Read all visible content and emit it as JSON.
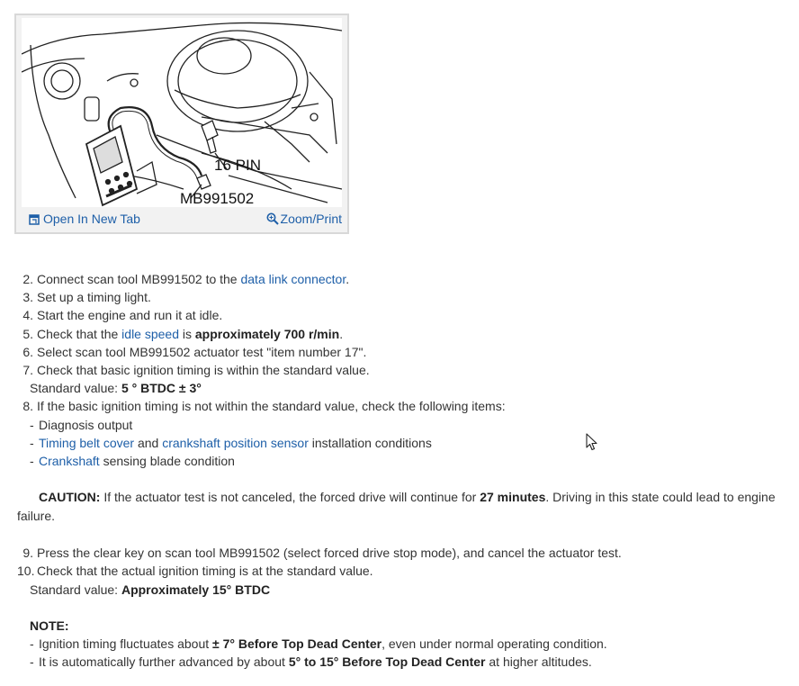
{
  "figure": {
    "label_pin": "16 PIN",
    "label_tool": "MB991502",
    "open_tab_label": "Open In New Tab",
    "zoom_label": "Zoom/Print"
  },
  "steps": [
    {
      "n": "2.",
      "pre": "Connect scan tool MB991502 to the ",
      "link": "data link connector",
      "post": "."
    },
    {
      "n": "3.",
      "text": "Set up a timing light."
    },
    {
      "n": "4.",
      "text": "Start the engine and run it at idle."
    },
    {
      "n": "5.",
      "pre": "Check that the ",
      "link": "idle speed",
      "mid": " is ",
      "bold": "approximately 700 r/min",
      "post": "."
    },
    {
      "n": "6.",
      "text": "Select scan tool MB991502 actuator test \"item number 17\"."
    },
    {
      "n": "7.",
      "text": "Check that basic ignition timing is within the standard value."
    }
  ],
  "std7": {
    "label": "Standard value: ",
    "value": "5 ° BTDC ± 3°"
  },
  "step8": {
    "n": "8.",
    "text": "If the basic ignition timing is not within the standard value, check the following items:"
  },
  "items8": {
    "a": "Diagnosis output",
    "b_link1": "Timing belt cover",
    "b_and": " and ",
    "b_link2": "crankshaft position sensor",
    "b_post": " installation conditions",
    "c_link": "Crankshaft",
    "c_post": " sensing blade condition"
  },
  "caution": {
    "label": "CAUTION:",
    "pre": " If the actuator test is not canceled, the forced drive will continue for ",
    "bold": "27 minutes",
    "post": ". Driving in this state could lead to engine failure."
  },
  "step9": {
    "n": "9.",
    "text": "Press the clear key on scan tool MB991502 (select forced drive stop mode), and cancel the actuator test."
  },
  "step10": {
    "n": "10.",
    "text": "Check that the actual ignition timing is at the standard value."
  },
  "std10": {
    "label": "Standard value: ",
    "value": "Approximately 15° BTDC"
  },
  "note": {
    "label": "NOTE:",
    "i1_pre": "Ignition timing fluctuates about ",
    "i1_bold": "± 7° Before Top Dead Center",
    "i1_post": ", even under normal operating condition.",
    "i2_pre": "It is automatically further advanced by about ",
    "i2_bold": "5° to 15° Before Top Dead Center",
    "i2_post": " at higher altitudes."
  },
  "dash": "-"
}
